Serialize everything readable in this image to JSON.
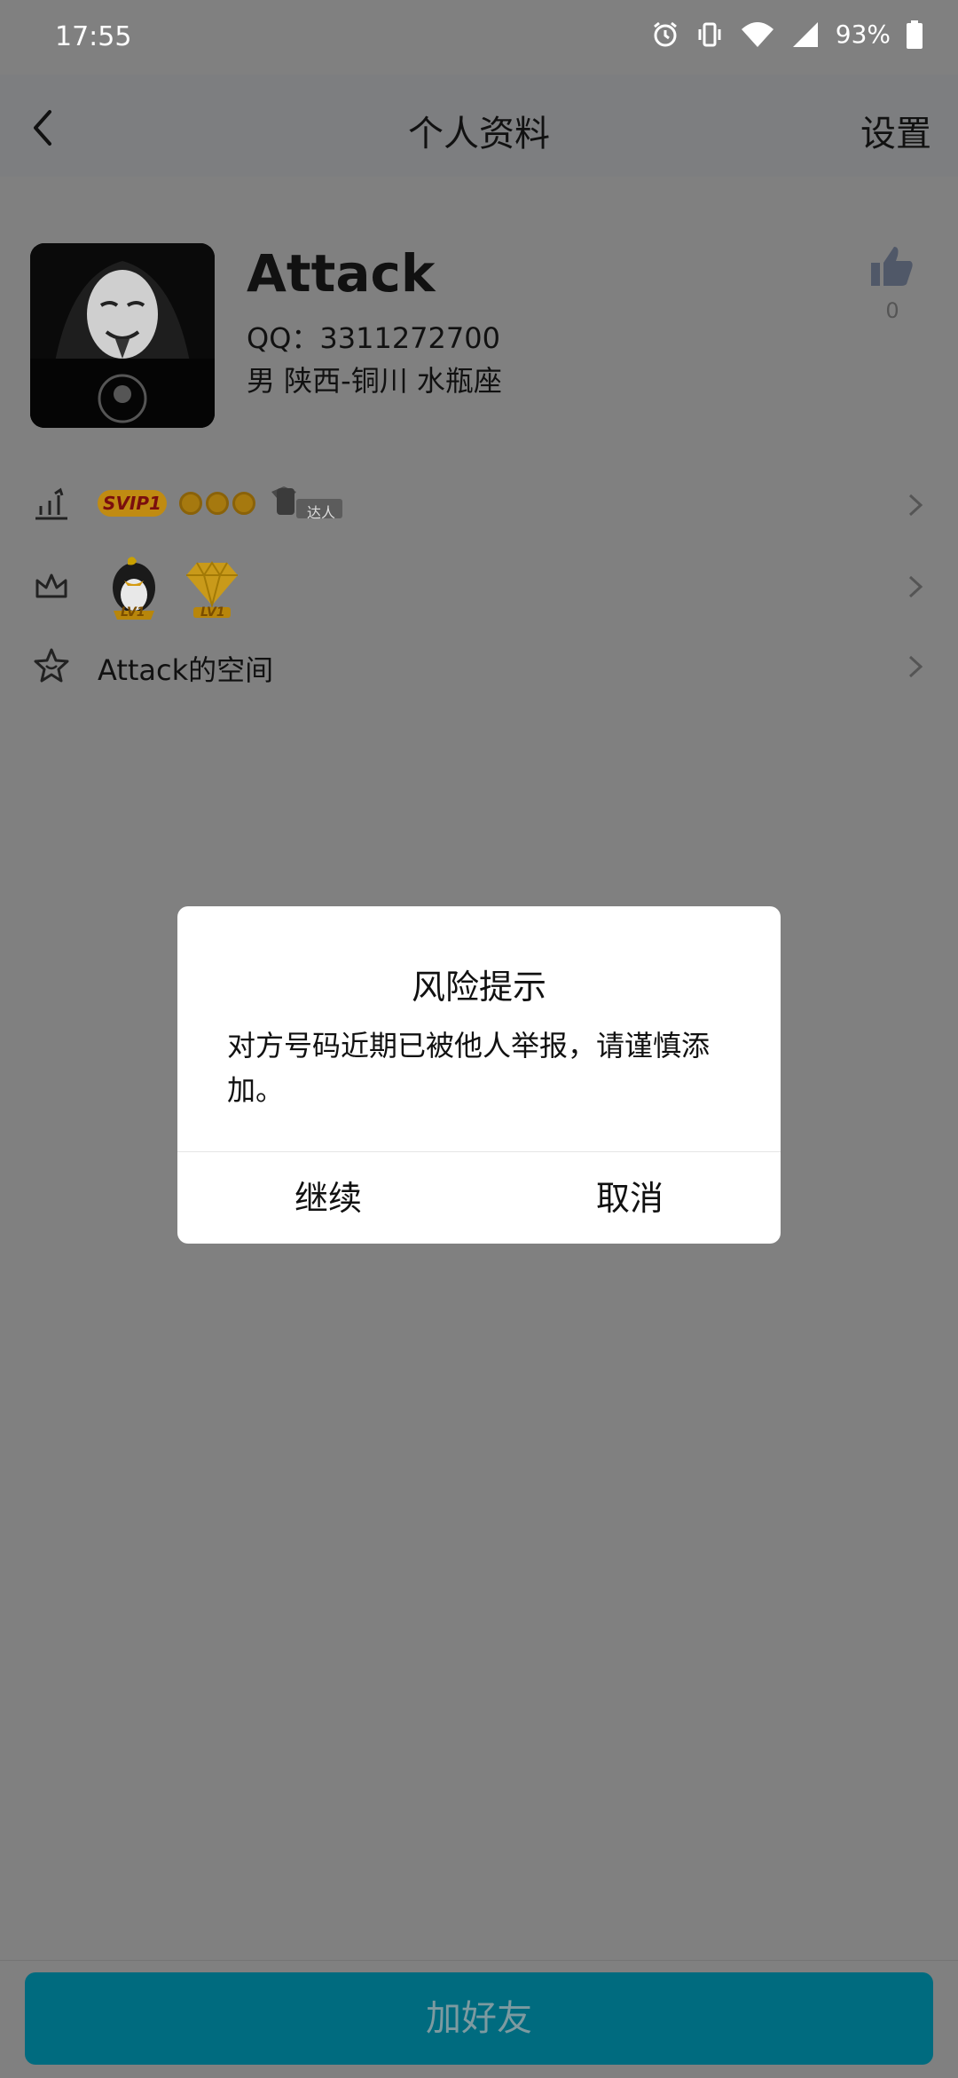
{
  "status": {
    "time": "17:55",
    "battery": "93%"
  },
  "header": {
    "title": "个人资料",
    "settings_label": "设置"
  },
  "profile": {
    "name": "Attack",
    "qq": "QQ：3311272700",
    "info": "男  陕西-铜川  水瓶座",
    "likes": "0"
  },
  "rows": {
    "vip": {
      "svip_badge": "SVIP1",
      "talent_badge": "达人"
    },
    "levels": {
      "penguin_level": "LV1",
      "diamond_level": "LV1"
    },
    "space": {
      "label": "Attack的空间"
    }
  },
  "dialog": {
    "title": "风险提示",
    "message": "对方号码近期已被他人举报，请谨慎添加。",
    "continue_label": "继续",
    "cancel_label": "取消"
  },
  "bottom": {
    "add_friend_label": "加好友"
  },
  "colors": {
    "overlay_bg": "#808080",
    "primary_button": "#006b7f",
    "dialog_bg": "#ffffff"
  }
}
